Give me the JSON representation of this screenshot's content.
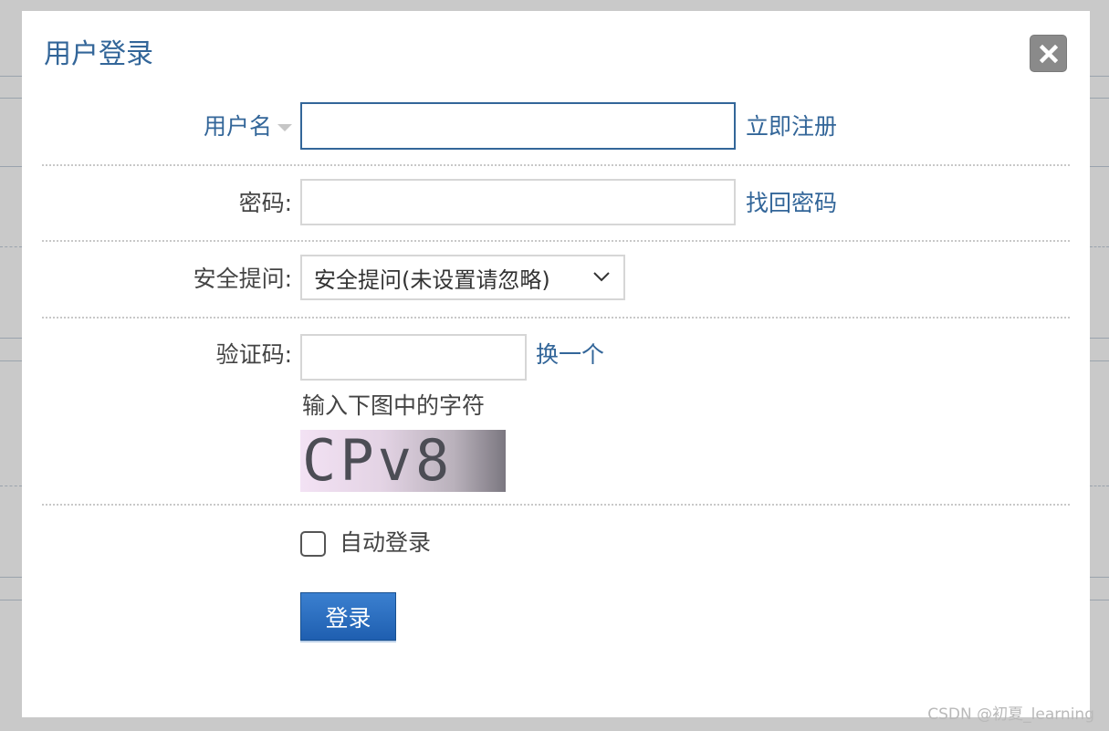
{
  "dialog": {
    "title": "用户登录",
    "close_icon": "close-icon"
  },
  "form": {
    "username": {
      "label": "用户名",
      "value": "",
      "link": "立即注册"
    },
    "password": {
      "label": "密码:",
      "value": "",
      "link": "找回密码"
    },
    "security_question": {
      "label": "安全提问:",
      "selected": "安全提问(未设置请忽略)"
    },
    "captcha": {
      "label": "验证码:",
      "value": "",
      "refresh_link": "换一个",
      "hint": "输入下图中的字符",
      "image_text": "CPv8"
    },
    "auto_login": {
      "label": "自动登录",
      "checked": false
    },
    "submit_label": "登录"
  },
  "watermark": "CSDN @初夏_learning",
  "colors": {
    "accent": "#336699",
    "button": "#2a6cc0",
    "overlay": "#c9c9c9"
  }
}
